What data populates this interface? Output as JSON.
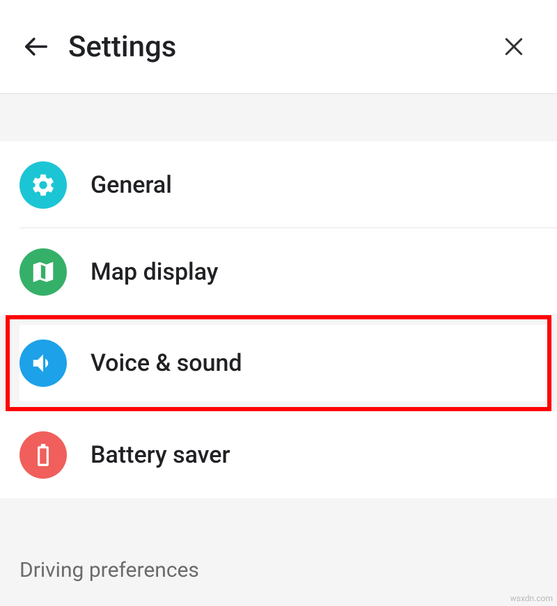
{
  "header": {
    "title": "Settings"
  },
  "items": {
    "general": {
      "label": "General"
    },
    "mapDisplay": {
      "label": "Map display"
    },
    "voiceSound": {
      "label": "Voice & sound"
    },
    "batterySaver": {
      "label": "Battery saver"
    }
  },
  "section": {
    "driving": "Driving preferences"
  },
  "watermark": "wsxdn.com"
}
